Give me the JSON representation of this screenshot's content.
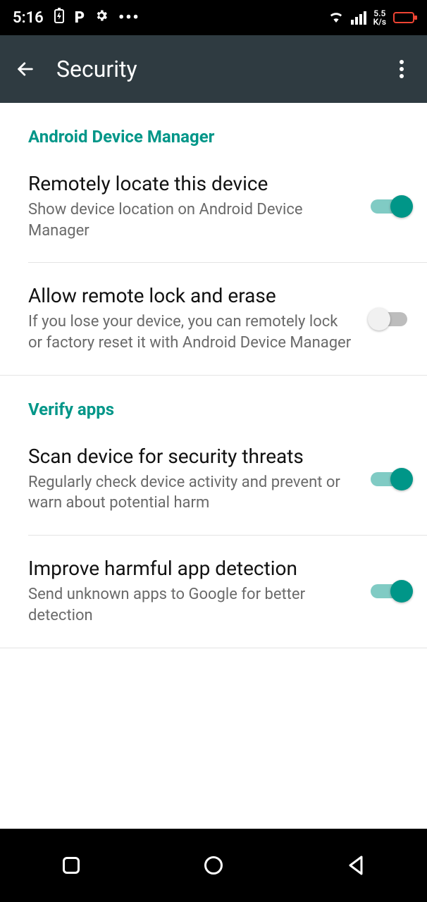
{
  "status": {
    "time": "5:16",
    "rate_top": "5.5",
    "rate_bot": "K/s"
  },
  "appbar": {
    "title": "Security"
  },
  "sections": {
    "adm": {
      "header": "Android Device Manager",
      "locate": {
        "title": "Remotely locate this device",
        "sub": "Show device location on Android Device Manager",
        "on": true
      },
      "lock": {
        "title": "Allow remote lock and erase",
        "sub": "If you lose your device, you can remotely lock or factory reset it with Android Device Manager",
        "on": false
      }
    },
    "verify": {
      "header": "Verify apps",
      "scan": {
        "title": "Scan device for security threats",
        "sub": "Regularly check device activity and prevent or warn about potential harm",
        "on": true
      },
      "improve": {
        "title": "Improve harmful app detection",
        "sub": "Send unknown apps to Google for better detection",
        "on": true
      }
    }
  }
}
